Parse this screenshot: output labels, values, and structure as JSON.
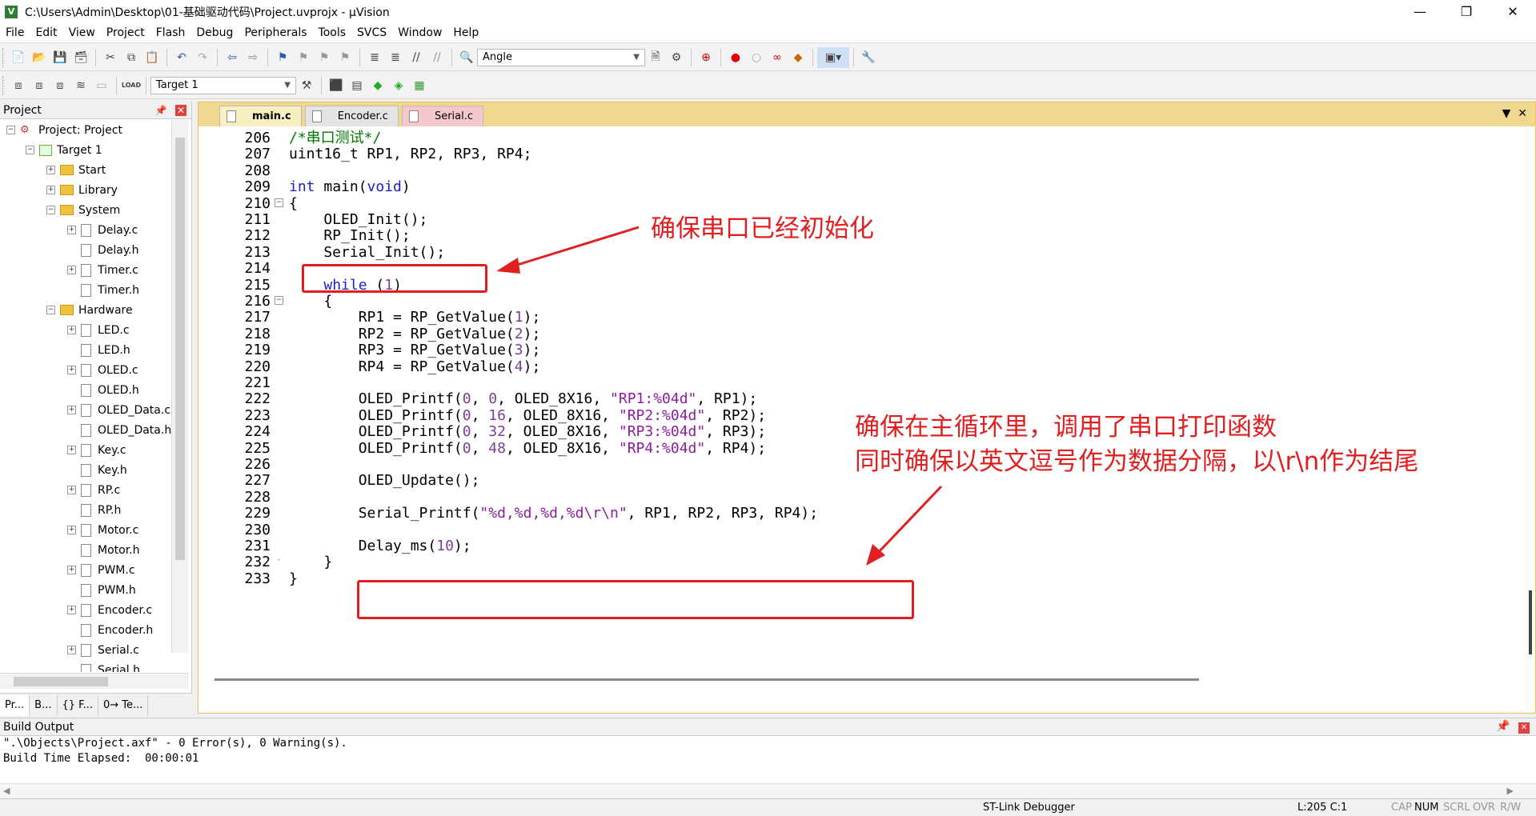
{
  "window": {
    "title": "C:\\Users\\Admin\\Desktop\\01-基础驱动代码\\Project.uvprojx - µVision",
    "app_icon": "V",
    "controls": [
      "—",
      "❐",
      "✕"
    ]
  },
  "menu": [
    "File",
    "Edit",
    "View",
    "Project",
    "Flash",
    "Debug",
    "Peripherals",
    "Tools",
    "SVCS",
    "Window",
    "Help"
  ],
  "toolbar1": {
    "search_combo_value": "Angle"
  },
  "toolbar2": {
    "target_combo_value": "Target 1",
    "load_label": "LOAD"
  },
  "project_panel": {
    "title": "Project",
    "tree": [
      {
        "label": "Project: Project",
        "level": 0,
        "toggle": "⊟",
        "icon": "proj"
      },
      {
        "label": "Target 1",
        "level": 1,
        "toggle": "⊟",
        "icon": "target"
      },
      {
        "label": "Start",
        "level": 2,
        "toggle": "+",
        "icon": "folder"
      },
      {
        "label": "Library",
        "level": 2,
        "toggle": "+",
        "icon": "folder"
      },
      {
        "label": "System",
        "level": 2,
        "toggle": "−",
        "icon": "folder"
      },
      {
        "label": "Delay.c",
        "level": 3,
        "toggle": "+",
        "icon": "file"
      },
      {
        "label": "Delay.h",
        "level": 3,
        "toggle": "",
        "icon": "file"
      },
      {
        "label": "Timer.c",
        "level": 3,
        "toggle": "+",
        "icon": "file"
      },
      {
        "label": "Timer.h",
        "level": 3,
        "toggle": "",
        "icon": "file"
      },
      {
        "label": "Hardware",
        "level": 2,
        "toggle": "−",
        "icon": "folder"
      },
      {
        "label": "LED.c",
        "level": 3,
        "toggle": "+",
        "icon": "file"
      },
      {
        "label": "LED.h",
        "level": 3,
        "toggle": "",
        "icon": "file"
      },
      {
        "label": "OLED.c",
        "level": 3,
        "toggle": "+",
        "icon": "file"
      },
      {
        "label": "OLED.h",
        "level": 3,
        "toggle": "",
        "icon": "file"
      },
      {
        "label": "OLED_Data.c",
        "level": 3,
        "toggle": "+",
        "icon": "file"
      },
      {
        "label": "OLED_Data.h",
        "level": 3,
        "toggle": "",
        "icon": "file"
      },
      {
        "label": "Key.c",
        "level": 3,
        "toggle": "+",
        "icon": "file"
      },
      {
        "label": "Key.h",
        "level": 3,
        "toggle": "",
        "icon": "file"
      },
      {
        "label": "RP.c",
        "level": 3,
        "toggle": "+",
        "icon": "file"
      },
      {
        "label": "RP.h",
        "level": 3,
        "toggle": "",
        "icon": "file"
      },
      {
        "label": "Motor.c",
        "level": 3,
        "toggle": "+",
        "icon": "file"
      },
      {
        "label": "Motor.h",
        "level": 3,
        "toggle": "",
        "icon": "file"
      },
      {
        "label": "PWM.c",
        "level": 3,
        "toggle": "+",
        "icon": "file"
      },
      {
        "label": "PWM.h",
        "level": 3,
        "toggle": "",
        "icon": "file"
      },
      {
        "label": "Encoder.c",
        "level": 3,
        "toggle": "+",
        "icon": "file"
      },
      {
        "label": "Encoder.h",
        "level": 3,
        "toggle": "",
        "icon": "file"
      },
      {
        "label": "Serial.c",
        "level": 3,
        "toggle": "+",
        "icon": "file"
      },
      {
        "label": "Serial.h",
        "level": 3,
        "toggle": "",
        "icon": "file"
      }
    ],
    "bottom_tabs": [
      "Pr...",
      "B...",
      "{} F...",
      "0→ Te..."
    ]
  },
  "editor": {
    "tabs": [
      "main.c",
      "Encoder.c",
      "Serial.c"
    ],
    "active_tab": "main.c",
    "lines": [
      {
        "n": "206",
        "fold": "",
        "segs": [
          [
            "cm",
            "/*串口测试*/"
          ]
        ]
      },
      {
        "n": "207",
        "fold": "",
        "segs": [
          [
            "",
            "uint16_t RP1, RP2, RP3, RP4;"
          ]
        ]
      },
      {
        "n": "208",
        "fold": "",
        "segs": []
      },
      {
        "n": "209",
        "fold": "",
        "segs": [
          [
            "kw",
            "int"
          ],
          [
            "",
            " main("
          ],
          [
            "kw",
            "void"
          ],
          [
            "",
            ")"
          ]
        ]
      },
      {
        "n": "210",
        "fold": "−",
        "segs": [
          [
            "",
            "{"
          ]
        ]
      },
      {
        "n": "211",
        "fold": "",
        "segs": [
          [
            "",
            "    OLED_Init();"
          ]
        ]
      },
      {
        "n": "212",
        "fold": "",
        "segs": [
          [
            "",
            "    RP_Init();"
          ]
        ]
      },
      {
        "n": "213",
        "fold": "",
        "segs": [
          [
            "",
            "    Serial_Init();"
          ]
        ]
      },
      {
        "n": "214",
        "fold": "",
        "segs": []
      },
      {
        "n": "215",
        "fold": "",
        "segs": [
          [
            "",
            "    "
          ],
          [
            "kw",
            "while"
          ],
          [
            "",
            " ("
          ],
          [
            "num",
            "1"
          ],
          [
            "",
            ")"
          ]
        ]
      },
      {
        "n": "216",
        "fold": "−",
        "segs": [
          [
            "",
            "    {"
          ]
        ]
      },
      {
        "n": "217",
        "fold": "",
        "segs": [
          [
            "",
            "        RP1 = RP_GetValue("
          ],
          [
            "num",
            "1"
          ],
          [
            "",
            ");"
          ]
        ]
      },
      {
        "n": "218",
        "fold": "",
        "segs": [
          [
            "",
            "        RP2 = RP_GetValue("
          ],
          [
            "num",
            "2"
          ],
          [
            "",
            ");"
          ]
        ]
      },
      {
        "n": "219",
        "fold": "",
        "segs": [
          [
            "",
            "        RP3 = RP_GetValue("
          ],
          [
            "num",
            "3"
          ],
          [
            "",
            ");"
          ]
        ]
      },
      {
        "n": "220",
        "fold": "",
        "segs": [
          [
            "",
            "        RP4 = RP_GetValue("
          ],
          [
            "num",
            "4"
          ],
          [
            "",
            ");"
          ]
        ]
      },
      {
        "n": "221",
        "fold": "",
        "segs": []
      },
      {
        "n": "222",
        "fold": "",
        "segs": [
          [
            "",
            "        OLED_Printf("
          ],
          [
            "num",
            "0"
          ],
          [
            "",
            ", "
          ],
          [
            "num",
            "0"
          ],
          [
            "",
            ", OLED_8X16, "
          ],
          [
            "str",
            "\"RP1:%04d\""
          ],
          [
            "",
            ", RP1);"
          ]
        ]
      },
      {
        "n": "223",
        "fold": "",
        "segs": [
          [
            "",
            "        OLED_Printf("
          ],
          [
            "num",
            "0"
          ],
          [
            "",
            ", "
          ],
          [
            "num",
            "16"
          ],
          [
            "",
            ", OLED_8X16, "
          ],
          [
            "str",
            "\"RP2:%04d\""
          ],
          [
            "",
            ", RP2);"
          ]
        ]
      },
      {
        "n": "224",
        "fold": "",
        "segs": [
          [
            "",
            "        OLED_Printf("
          ],
          [
            "num",
            "0"
          ],
          [
            "",
            ", "
          ],
          [
            "num",
            "32"
          ],
          [
            "",
            ", OLED_8X16, "
          ],
          [
            "str",
            "\"RP3:%04d\""
          ],
          [
            "",
            ", RP3);"
          ]
        ]
      },
      {
        "n": "225",
        "fold": "",
        "segs": [
          [
            "",
            "        OLED_Printf("
          ],
          [
            "num",
            "0"
          ],
          [
            "",
            ", "
          ],
          [
            "num",
            "48"
          ],
          [
            "",
            ", OLED_8X16, "
          ],
          [
            "str",
            "\"RP4:%04d\""
          ],
          [
            "",
            ", RP4);"
          ]
        ]
      },
      {
        "n": "226",
        "fold": "",
        "segs": []
      },
      {
        "n": "227",
        "fold": "",
        "segs": [
          [
            "",
            "        OLED_Update();"
          ]
        ]
      },
      {
        "n": "228",
        "fold": "",
        "segs": []
      },
      {
        "n": "229",
        "fold": "",
        "segs": [
          [
            "",
            "        Serial_Printf("
          ],
          [
            "str",
            "\"%d,%d,%d,%d\\r\\n\""
          ],
          [
            "",
            ", RP1, RP2, RP3, RP4);"
          ]
        ]
      },
      {
        "n": "230",
        "fold": "",
        "segs": []
      },
      {
        "n": "231",
        "fold": "",
        "segs": [
          [
            "",
            "        Delay_ms("
          ],
          [
            "num",
            "10"
          ],
          [
            "",
            ");"
          ]
        ]
      },
      {
        "n": "232",
        "fold": "-",
        "segs": [
          [
            "",
            "    }"
          ]
        ]
      },
      {
        "n": "233",
        "fold": "",
        "segs": [
          [
            "",
            "}"
          ]
        ]
      }
    ]
  },
  "annotations": {
    "note1": "确保串口已经初始化",
    "note2_line1": "确保在主循环里，调用了串口打印函数",
    "note2_line2": "同时确保以英文逗号作为数据分隔，以\\r\\n作为结尾",
    "color": "#e02020"
  },
  "build_output": {
    "title": "Build Output",
    "lines": [
      "\".\\Objects\\Project.axf\" - 0 Error(s), 0 Warning(s).",
      "Build Time Elapsed:  00:00:01"
    ]
  },
  "status_bar": {
    "debugger": "ST-Link Debugger",
    "position": "L:205 C:1",
    "caps": "CAP",
    "num": "NUM",
    "scrl": "SCRL",
    "ovr": "OVR",
    "rw": "R/W"
  }
}
